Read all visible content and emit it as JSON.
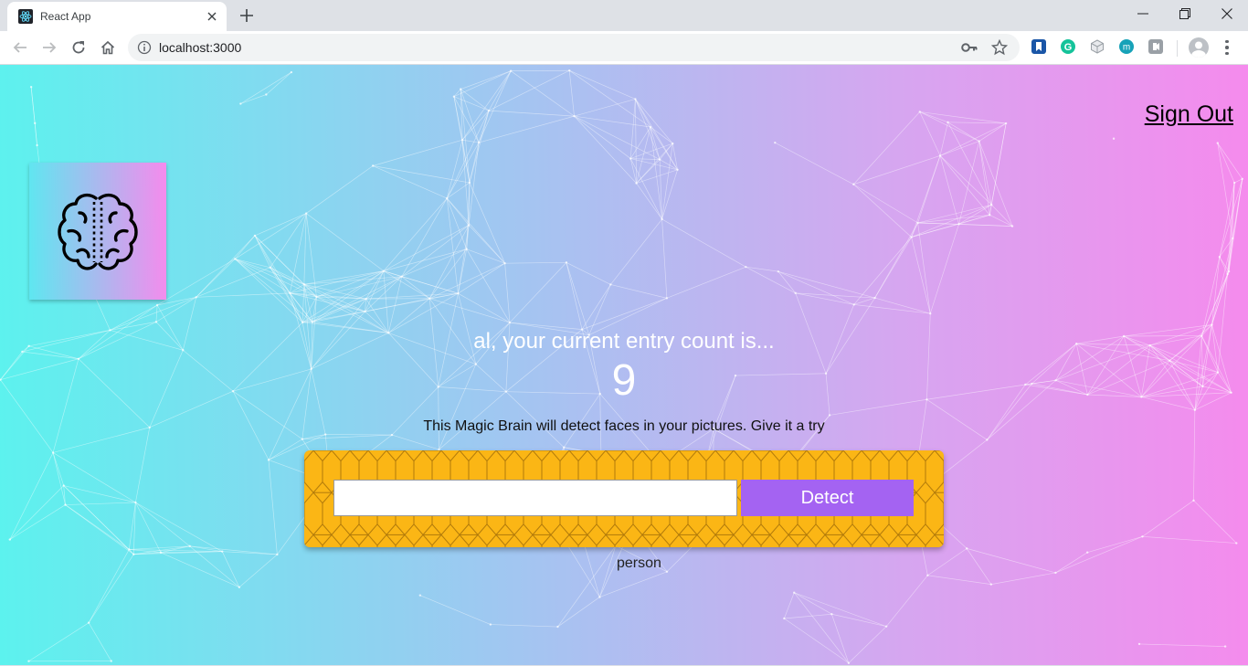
{
  "browser": {
    "tab_title": "React App",
    "url": "localhost:3000"
  },
  "nav": {
    "sign_out": "Sign Out"
  },
  "rank": {
    "greeting": "al, your current entry count is...",
    "count": "9"
  },
  "form": {
    "description": "This Magic Brain will detect faces in your pictures. Give it a try",
    "input_value": "",
    "button_label": "Detect"
  },
  "result": {
    "label": "person"
  },
  "colors": {
    "gradient_start": "#5cf2ee",
    "gradient_end": "#f58bed",
    "panel": "#fbb615",
    "button": "#a463f2"
  },
  "icons": {
    "logo": "brain-icon"
  }
}
